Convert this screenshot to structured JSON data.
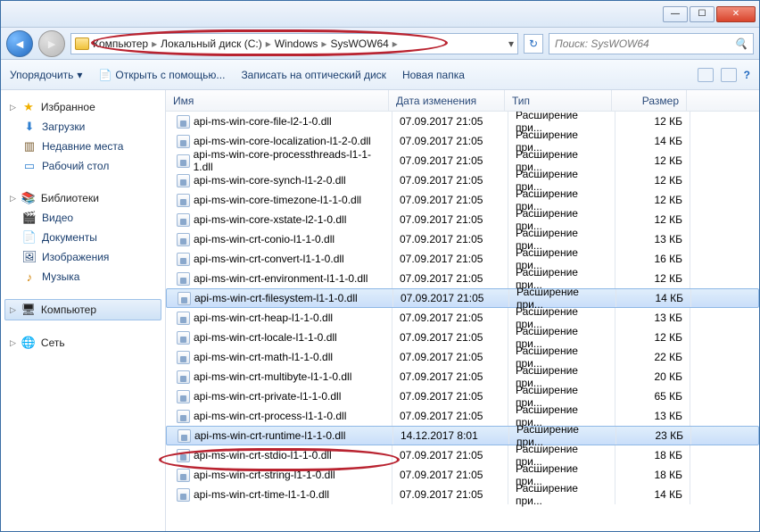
{
  "window": {
    "min": "—",
    "max": "☐",
    "close": "✕"
  },
  "breadcrumb": [
    "Компьютер",
    "Локальный диск (C:)",
    "Windows",
    "SysWOW64"
  ],
  "search_placeholder": "Поиск: SysWOW64",
  "toolbar": {
    "organize": "Упорядочить",
    "openwith": "Открыть с помощью...",
    "burn": "Записать на оптический диск",
    "newfolder": "Новая папка"
  },
  "sidebar": {
    "fav": "Избранное",
    "fav_items": [
      "Загрузки",
      "Недавние места",
      "Рабочий стол"
    ],
    "lib": "Библиотеки",
    "lib_items": [
      "Видео",
      "Документы",
      "Изображения",
      "Музыка"
    ],
    "comp": "Компьютер",
    "net": "Сеть"
  },
  "columns": {
    "name": "Имя",
    "date": "Дата изменения",
    "type": "Тип",
    "size": "Размер"
  },
  "type_label": "Расширение при...",
  "files": [
    {
      "n": "api-ms-win-core-file-l2-1-0.dll",
      "d": "07.09.2017 21:05",
      "s": "12 КБ",
      "sel": false
    },
    {
      "n": "api-ms-win-core-localization-l1-2-0.dll",
      "d": "07.09.2017 21:05",
      "s": "14 КБ",
      "sel": false
    },
    {
      "n": "api-ms-win-core-processthreads-l1-1-1.dll",
      "d": "07.09.2017 21:05",
      "s": "12 КБ",
      "sel": false
    },
    {
      "n": "api-ms-win-core-synch-l1-2-0.dll",
      "d": "07.09.2017 21:05",
      "s": "12 КБ",
      "sel": false
    },
    {
      "n": "api-ms-win-core-timezone-l1-1-0.dll",
      "d": "07.09.2017 21:05",
      "s": "12 КБ",
      "sel": false
    },
    {
      "n": "api-ms-win-core-xstate-l2-1-0.dll",
      "d": "07.09.2017 21:05",
      "s": "12 КБ",
      "sel": false
    },
    {
      "n": "api-ms-win-crt-conio-l1-1-0.dll",
      "d": "07.09.2017 21:05",
      "s": "13 КБ",
      "sel": false
    },
    {
      "n": "api-ms-win-crt-convert-l1-1-0.dll",
      "d": "07.09.2017 21:05",
      "s": "16 КБ",
      "sel": false
    },
    {
      "n": "api-ms-win-crt-environment-l1-1-0.dll",
      "d": "07.09.2017 21:05",
      "s": "12 КБ",
      "sel": false
    },
    {
      "n": "api-ms-win-crt-filesystem-l1-1-0.dll",
      "d": "07.09.2017 21:05",
      "s": "14 КБ",
      "sel": true
    },
    {
      "n": "api-ms-win-crt-heap-l1-1-0.dll",
      "d": "07.09.2017 21:05",
      "s": "13 КБ",
      "sel": false
    },
    {
      "n": "api-ms-win-crt-locale-l1-1-0.dll",
      "d": "07.09.2017 21:05",
      "s": "12 КБ",
      "sel": false
    },
    {
      "n": "api-ms-win-crt-math-l1-1-0.dll",
      "d": "07.09.2017 21:05",
      "s": "22 КБ",
      "sel": false
    },
    {
      "n": "api-ms-win-crt-multibyte-l1-1-0.dll",
      "d": "07.09.2017 21:05",
      "s": "20 КБ",
      "sel": false
    },
    {
      "n": "api-ms-win-crt-private-l1-1-0.dll",
      "d": "07.09.2017 21:05",
      "s": "65 КБ",
      "sel": false
    },
    {
      "n": "api-ms-win-crt-process-l1-1-0.dll",
      "d": "07.09.2017 21:05",
      "s": "13 КБ",
      "sel": false
    },
    {
      "n": "api-ms-win-crt-runtime-l1-1-0.dll",
      "d": "14.12.2017 8:01",
      "s": "23 КБ",
      "sel": true
    },
    {
      "n": "api-ms-win-crt-stdio-l1-1-0.dll",
      "d": "07.09.2017 21:05",
      "s": "18 КБ",
      "sel": false
    },
    {
      "n": "api-ms-win-crt-string-l1-1-0.dll",
      "d": "07.09.2017 21:05",
      "s": "18 КБ",
      "sel": false
    },
    {
      "n": "api-ms-win-crt-time-l1-1-0.dll",
      "d": "07.09.2017 21:05",
      "s": "14 КБ",
      "sel": false
    }
  ],
  "icons": {
    "fav": "★",
    "dl": "⬇",
    "recent": "▥",
    "desk": "▭",
    "lib": "📚",
    "vid": "🎬",
    "doc": "📄",
    "img": "🖼",
    "mus": "♪",
    "comp": "🖥",
    "net": "🌐",
    "search": "🔍",
    "chev": "▸",
    "dd": "▾",
    "help": "?"
  }
}
